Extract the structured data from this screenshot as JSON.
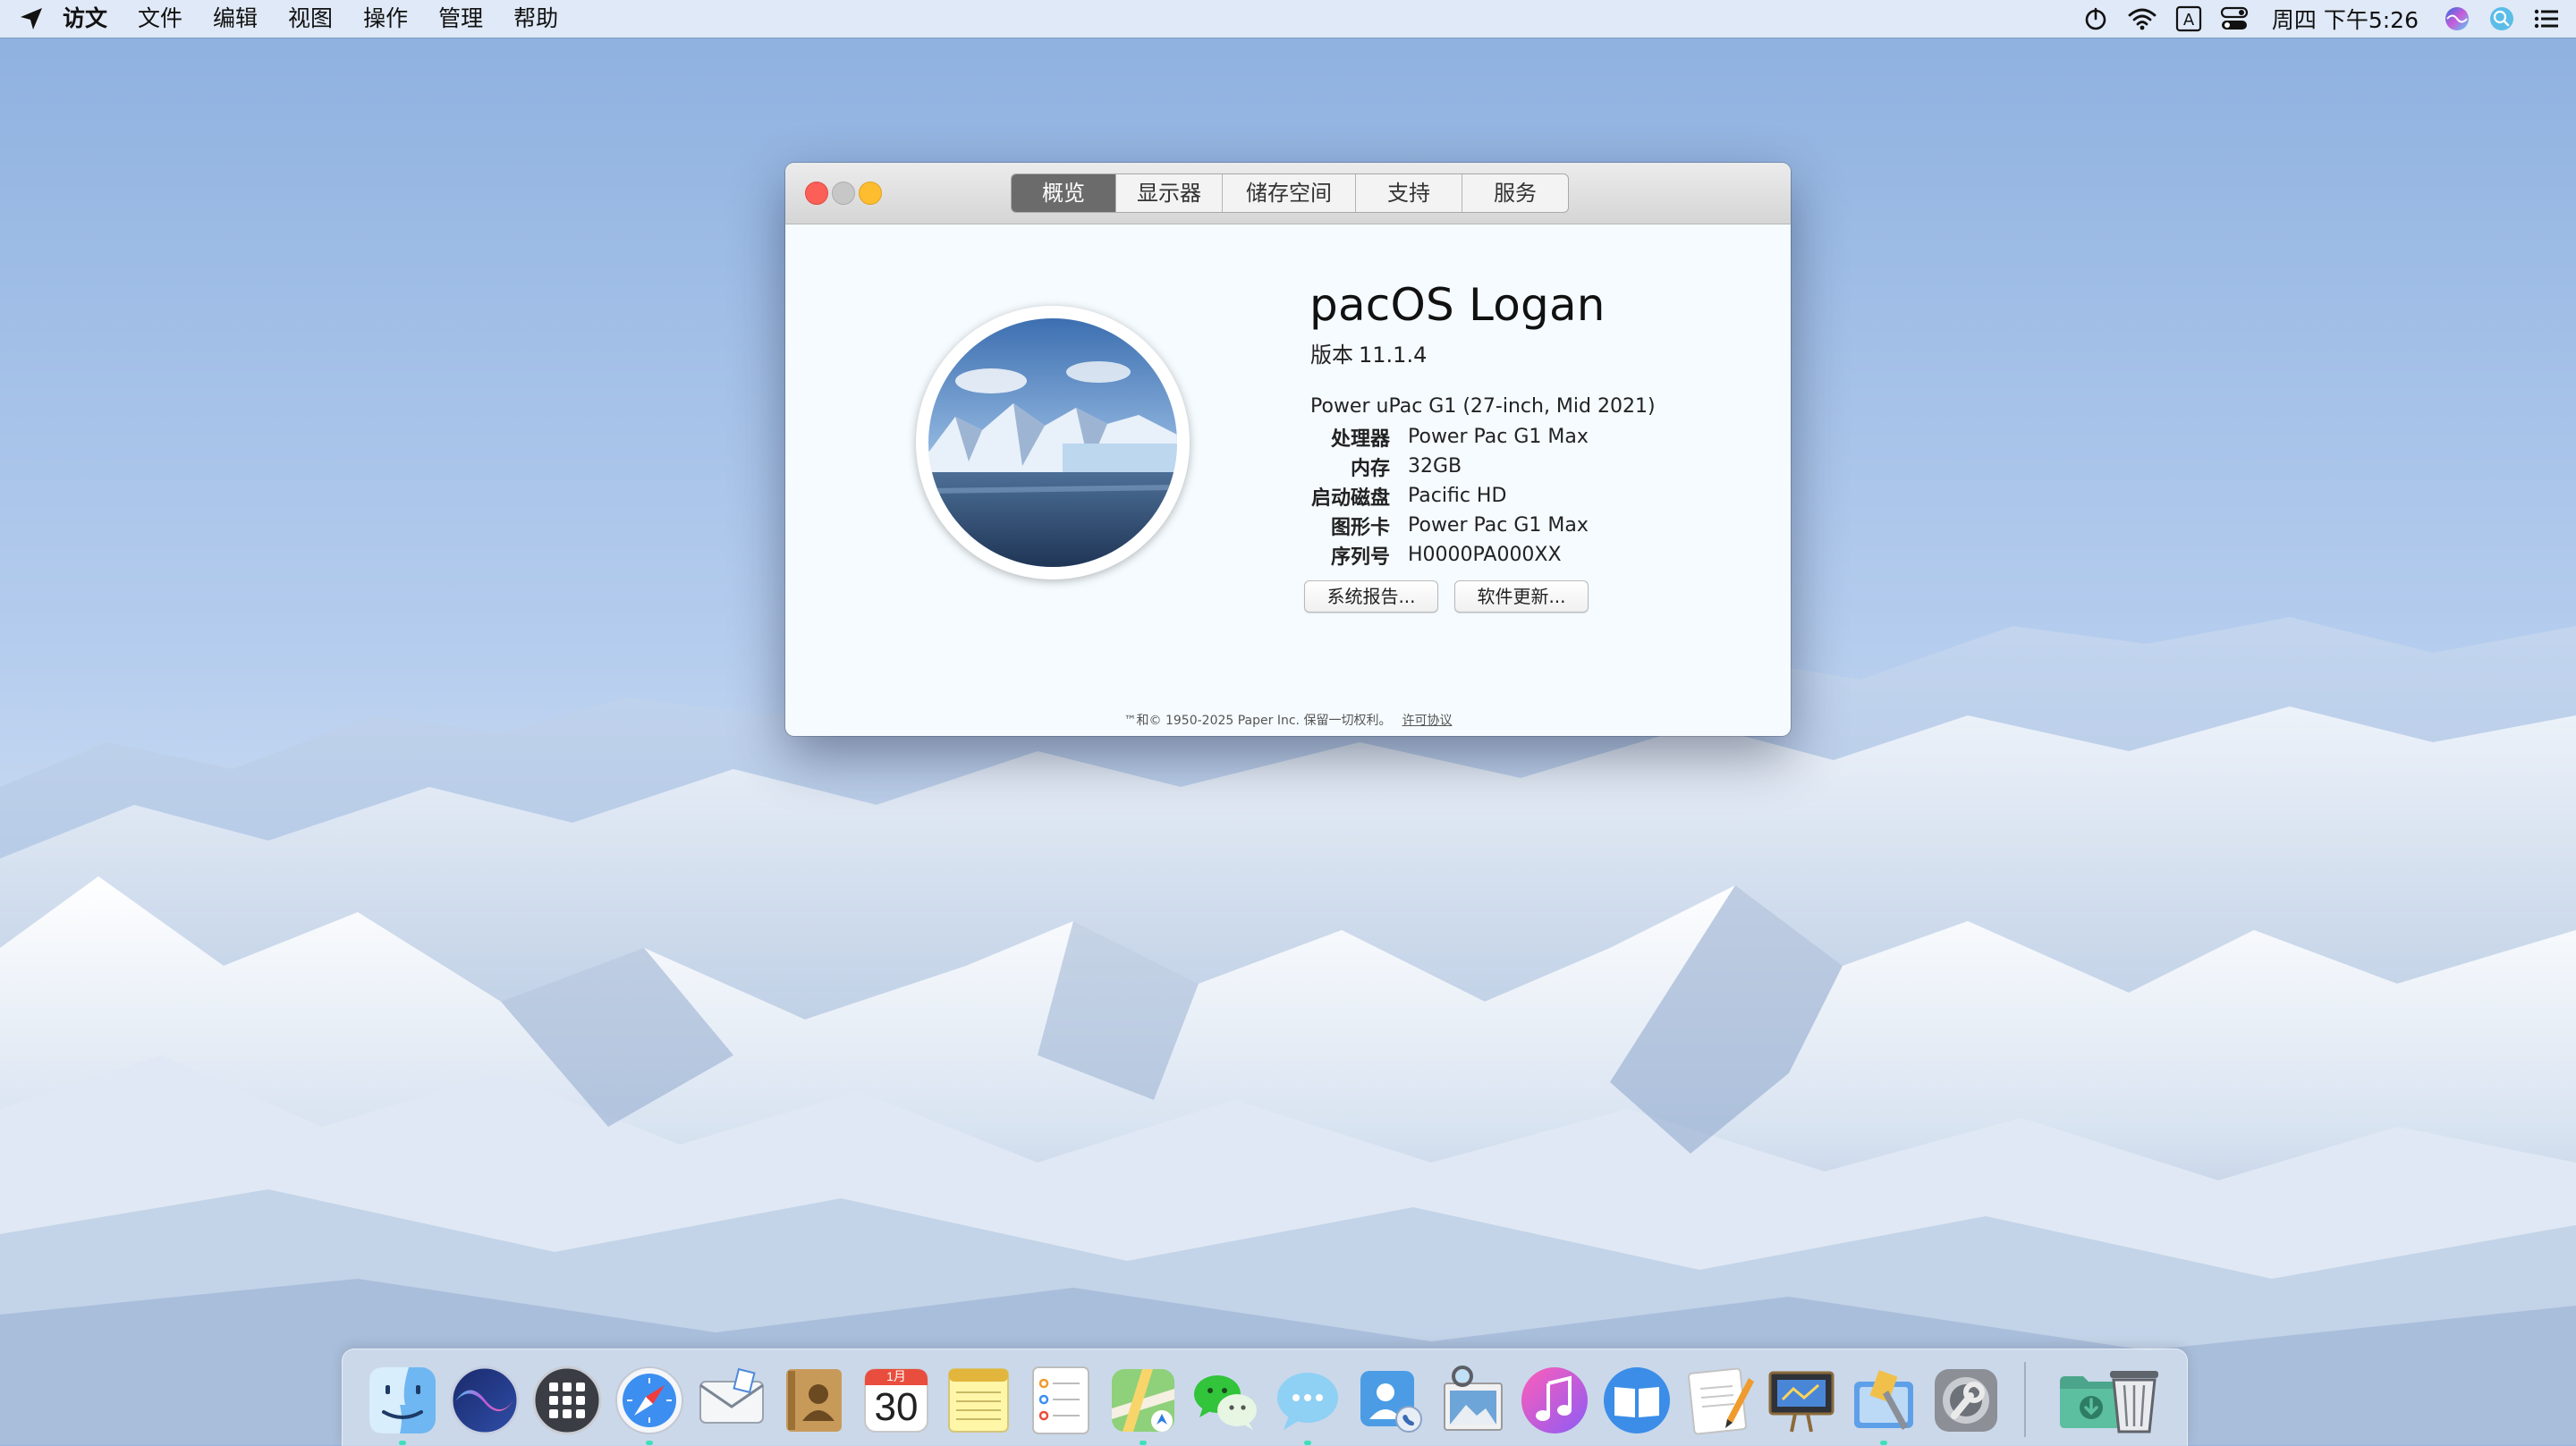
{
  "menubar": {
    "app_name": "访文",
    "items": [
      "文件",
      "编辑",
      "视图",
      "操作",
      "管理",
      "帮助"
    ],
    "input_method_label": "A",
    "clock": "周四 下午5:26"
  },
  "window": {
    "tabs": [
      {
        "label": "概览",
        "active": true
      },
      {
        "label": "显示器",
        "active": false
      },
      {
        "label": "储存空间",
        "active": false
      },
      {
        "label": "支持",
        "active": false
      },
      {
        "label": "服务",
        "active": false
      }
    ],
    "os_name": "pacOS Logan",
    "version_label": "版本",
    "version": "11.1.4",
    "model": "Power uPac G1 (27-inch, Mid 2021)",
    "specs": [
      {
        "key": "处理器",
        "value": "Power Pac G1 Max"
      },
      {
        "key": "内存",
        "value": "32GB"
      },
      {
        "key": "启动磁盘",
        "value": "Pacific HD"
      },
      {
        "key": "图形卡",
        "value": "Power Pac G1 Max"
      },
      {
        "key": "序列号",
        "value": "H0000PA000XX"
      }
    ],
    "buttons": {
      "report": "系统报告...",
      "update": "软件更新..."
    },
    "footer": {
      "copyright": "™和© 1950-2025 Paper Inc. 保留一切权利。",
      "license": "许可协议"
    }
  },
  "dock": {
    "calendar": {
      "month": "1月",
      "day": "30"
    },
    "apps": [
      "finder-icon",
      "siri-icon",
      "launchpad-icon",
      "safari-icon",
      "mail-icon",
      "contacts-icon",
      "calendar-icon",
      "notes-icon",
      "reminders-icon",
      "maps-icon",
      "wechat-icon",
      "messages-icon",
      "facetime-icon",
      "preview-icon",
      "music-icon",
      "books-icon",
      "pages-icon",
      "keynote-icon",
      "xcode-icon",
      "system-preferences-icon",
      "downloads-folder-icon",
      "trash-icon"
    ],
    "colors": {
      "running_indicator": "#3fe0b8",
      "close": "#fc5f57",
      "minimize": "#c7c7c7",
      "zoom": "#fdbd2e"
    }
  }
}
